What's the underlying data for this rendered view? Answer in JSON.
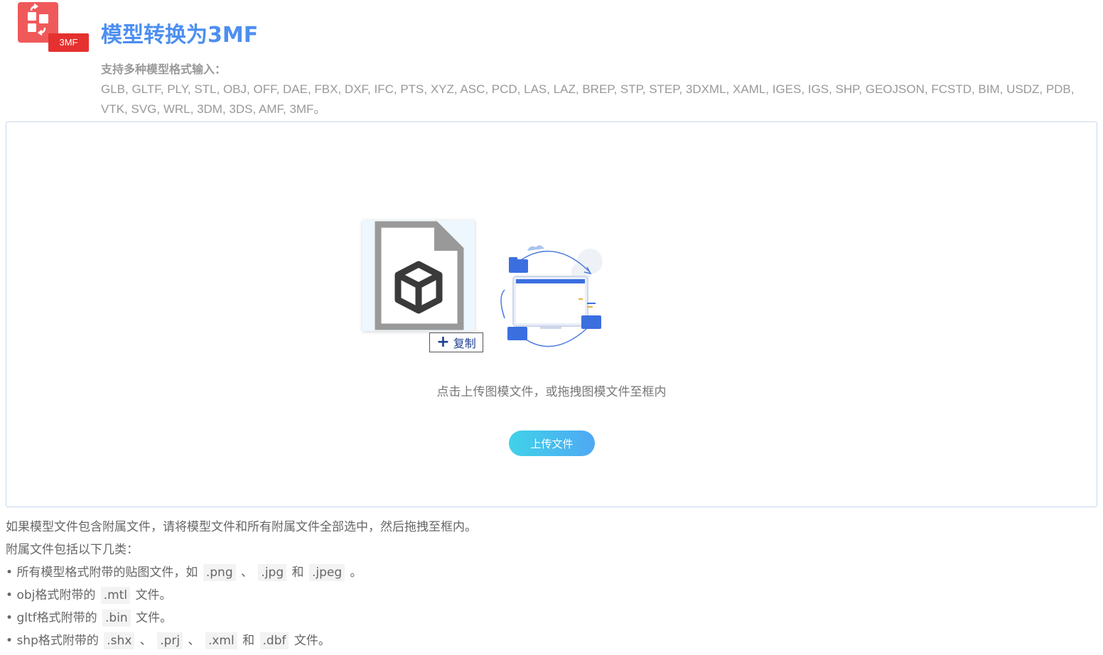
{
  "header": {
    "logo_badge": "3MF",
    "title": "模型转换为3MF",
    "formats_label": "支持多种模型格式输入：",
    "formats_list": "GLB, GLTF, PLY, STL, OBJ, OFF, DAE, FBX, DXF, IFC, PTS, XYZ, ASC, PCD, LAS, LAZ, BREP, STP, STEP, 3DXML, XAML, IGES, IGS, SHP, GEOJSON, FCSTD, BIM, USDZ, PDB, VTK, SVG, WRL, 3DM, 3DS, AMF, 3MF。"
  },
  "dropzone": {
    "copy_label": "复制",
    "hint": "点击上传图模文件，或拖拽图模文件至框内",
    "upload_button": "上传文件"
  },
  "notes": {
    "line1": "如果模型文件包含附属文件，请将模型文件和所有附属文件全部选中，然后拖拽至框内。",
    "line2": "附属文件包括以下几类：",
    "bullet": "•",
    "sep": "、",
    "and": "和",
    "end_period": "。",
    "files_suffix": "文件。",
    "item1_text": "所有模型格式附带的贴图文件，如",
    "item1_codes": [
      ".png",
      ".jpg",
      ".jpeg"
    ],
    "item2_text": "obj格式附带的",
    "item2_code": ".mtl",
    "item3_text": "gltf格式附带的",
    "item3_code": ".bin",
    "item4_text": "shp格式附带的",
    "item4_codes": [
      ".shx",
      ".prj",
      ".xml",
      ".dbf"
    ]
  },
  "colors": {
    "title": "#4d8ff0",
    "logo_tile": "#f0595a",
    "logo_badge": "#e5312f",
    "button_gradient_start": "#40d2e8",
    "button_gradient_end": "#4fa8f3",
    "dropzone_border": "#c6d9ee"
  },
  "icons": {
    "logo": "convert-arrows-icon",
    "file": "3d-model-file-icon",
    "copy": "plus-icon",
    "illustration": "sync-computer-illustration"
  }
}
